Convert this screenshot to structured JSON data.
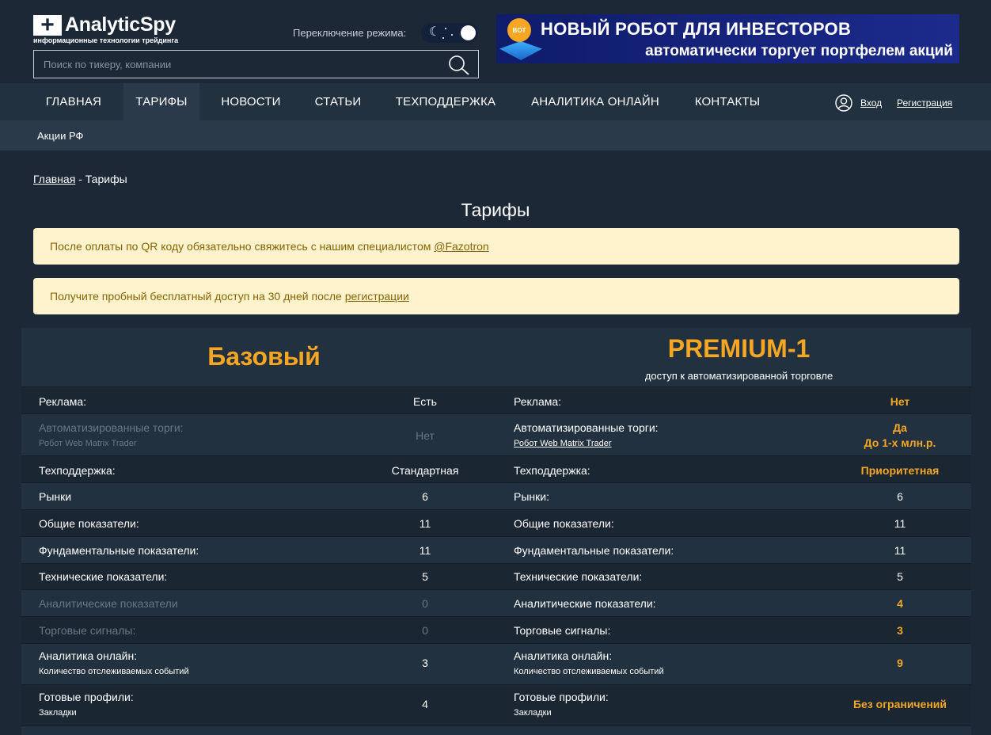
{
  "header": {
    "logo_text": "AnalyticSpy",
    "logo_sub": "информационные технологии трейдинга",
    "mode_label": "Переключение режима:",
    "search_placeholder": "Поиск по тикеру, компании",
    "banner": {
      "badge": "BOT",
      "line1": "НОВЫЙ РОБОТ ДЛЯ ИНВЕСТОРОВ",
      "line2": "автоматически торгует портфелем акций"
    }
  },
  "nav": {
    "items": [
      "ГЛАВНАЯ",
      "ТАРИФЫ",
      "НОВОСТИ",
      "СТАТЬИ",
      "ТЕХПОДДЕРЖКА",
      "АНАЛИТИКА ОНЛАЙН",
      "КОНТАКТЫ"
    ],
    "active": "ТАРИФЫ",
    "login": "Вход",
    "register": "Регистрация"
  },
  "subnav": {
    "item": "Акции РФ"
  },
  "breadcrumb": {
    "home": "Главная",
    "separator": " - ",
    "current": "Тарифы"
  },
  "page_title": "Тарифы",
  "alerts": {
    "qr_text": "После оплаты по QR коду обязательно свяжитесь с нашим специалистом ",
    "qr_link": "@Fazotron",
    "trial_text": "Получите пробный бесплатный доступ на 30 дней после ",
    "trial_link": "регистрации"
  },
  "plans": {
    "basic": {
      "name": "Базовый"
    },
    "premium": {
      "name": "PREMIUM-1",
      "subtitle": "доступ к автоматизированной торговле"
    }
  },
  "rows": [
    {
      "label": "Реклама:",
      "basic": "Есть",
      "premium": "Нет"
    },
    {
      "label": "Автоматизированные торги:",
      "sub": "Робот Web Matrix Trader",
      "basic": "Нет",
      "premium": "Да",
      "premium2": "До 1-х млн.р."
    },
    {
      "label": "Техподдержка:",
      "basic": "Стандартная",
      "premium": "Приоритетная"
    },
    {
      "label": "Рынки",
      "label_premium": "Рынки:",
      "basic": "6",
      "premium": "6"
    },
    {
      "label": "Общие показатели:",
      "basic": "11",
      "premium": "11"
    },
    {
      "label": "Фундаментальные показатели:",
      "basic": "11",
      "premium": "11"
    },
    {
      "label": "Технические показатели:",
      "basic": "5",
      "premium": "5"
    },
    {
      "label": "Аналитические показатели",
      "label_premium": "Аналитические показатели:",
      "basic": "0",
      "premium": "4"
    },
    {
      "label": "Торговые сигналы:",
      "basic": "0",
      "premium": "3"
    },
    {
      "label": "Аналитика онлайн:",
      "sub": "Количество отслеживаемых событий",
      "basic": "3",
      "premium": "9"
    },
    {
      "label": "Готовые профили:",
      "sub": "Закладки",
      "basic": "4",
      "premium": "Без ограничений"
    }
  ],
  "colors": {
    "background": "#1c2836",
    "nav": "#22313f",
    "accent": "#f5a623",
    "alert_bg": "#fff3cd",
    "alert_text": "#856404",
    "dim_text": "#6b7683"
  },
  "icons": {
    "search": "search-icon",
    "user": "user-icon",
    "mode": "moon-icon"
  }
}
